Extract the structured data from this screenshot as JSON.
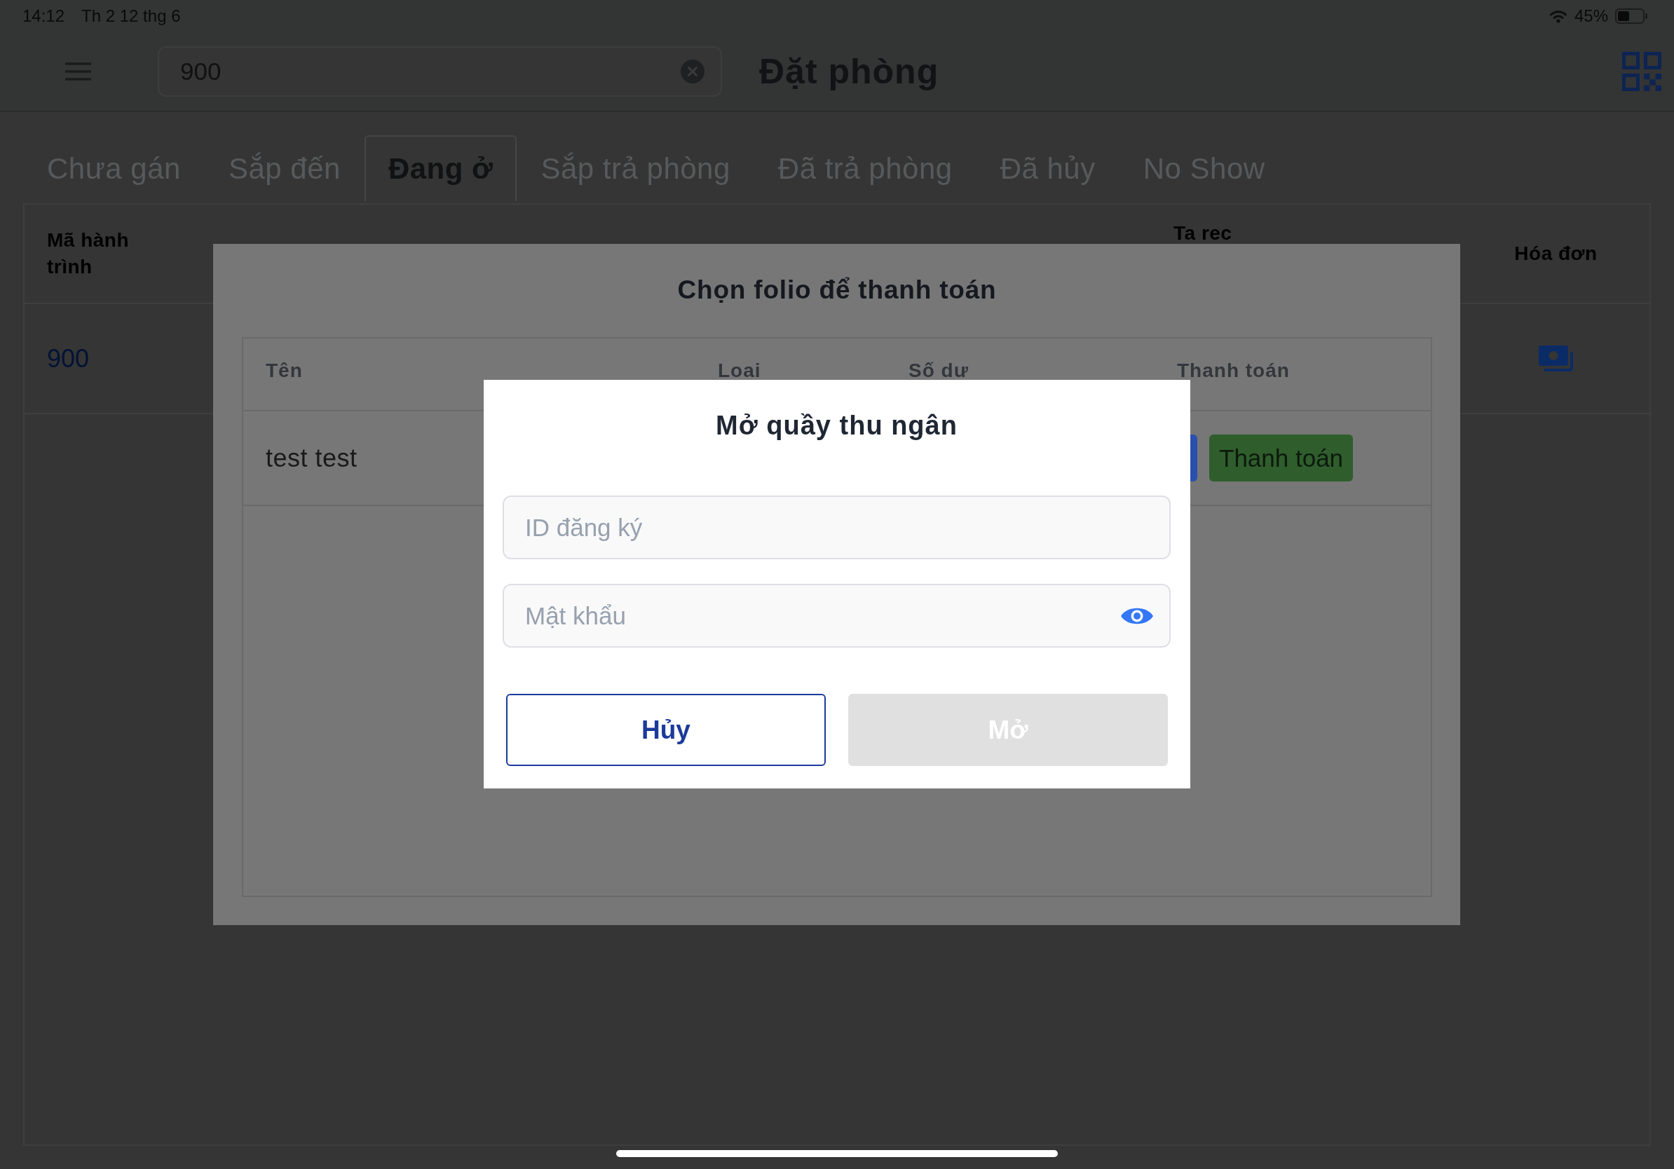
{
  "status_bar": {
    "time": "14:12",
    "date": "Th 2 12 thg 6",
    "battery": "45%"
  },
  "header": {
    "search": {
      "value": "900"
    },
    "title": "Đặt phòng"
  },
  "tabs": [
    {
      "label": "Chưa gán",
      "selected": false
    },
    {
      "label": "Sắp đến",
      "selected": false
    },
    {
      "label": "Đang ở",
      "selected": true
    },
    {
      "label": "Sắp trả phòng",
      "selected": false
    },
    {
      "label": "Đã trả phòng",
      "selected": false
    },
    {
      "label": "Đã hủy",
      "selected": false
    },
    {
      "label": "No Show",
      "selected": false
    }
  ],
  "table": {
    "columns": [
      "Mã hành trình",
      "Ta rec",
      "Hóa đơn"
    ],
    "rows": [
      {
        "code": "900"
      }
    ]
  },
  "folio_dialog": {
    "title": "Chọn folio để thanh toán",
    "columns": [
      "Tên",
      "Loai",
      "Số dư",
      "Thanh toán"
    ],
    "rows": [
      {
        "name": "test test",
        "pay_button": "Thanh toán"
      }
    ]
  },
  "cashier_dialog": {
    "title": "Mở quầy thu ngân",
    "fields": [
      {
        "kind": "text",
        "placeholder": "ID đăng ký"
      },
      {
        "kind": "password",
        "placeholder": "Mật khẩu"
      }
    ],
    "buttons": [
      {
        "label": "Hủy",
        "kind": "secondary",
        "disabled": false
      },
      {
        "label": "Mở",
        "kind": "primary",
        "disabled": true
      }
    ]
  }
}
